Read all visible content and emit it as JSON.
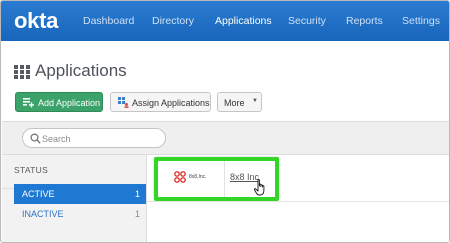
{
  "nav": {
    "logo": "okta",
    "items": [
      {
        "label": "Dashboard"
      },
      {
        "label": "Directory"
      },
      {
        "label": "Applications"
      },
      {
        "label": "Security"
      },
      {
        "label": "Reports"
      },
      {
        "label": "Settings"
      }
    ]
  },
  "page": {
    "title": "Applications"
  },
  "toolbar": {
    "add_label": "Add Application",
    "assign_label": "Assign Applications",
    "more_label": "More"
  },
  "search": {
    "placeholder": "Search",
    "value": ""
  },
  "sidebar": {
    "header": "STATUS",
    "items": [
      {
        "label": "ACTIVE",
        "count": "1"
      },
      {
        "label": "INACTIVE",
        "count": "1"
      }
    ]
  },
  "apps": [
    {
      "logo_text": "8x8,Inc.",
      "name": "8x8 Inc"
    }
  ],
  "colors": {
    "nav_bg": "#1e6fc6",
    "add_button": "#3ba36a",
    "active_status": "#1f78d1",
    "highlight": "#33d625"
  }
}
